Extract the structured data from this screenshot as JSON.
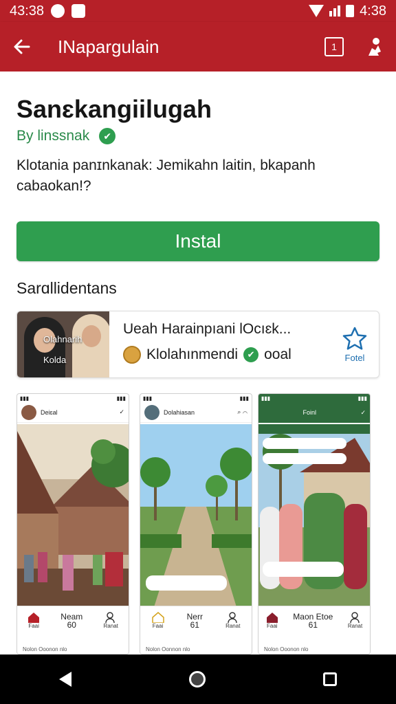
{
  "status_bar": {
    "time_left": "43:38",
    "time_right": "4:38"
  },
  "app_bar": {
    "title": "INapargulain",
    "action_box_label": "1"
  },
  "app": {
    "name": "Sanɛkangiilugah",
    "developer": "By linssnak",
    "description": "Klotania panɪnkanak: Jemikahn laitin, bkapanh cabaokan!?",
    "install_label": "Instal"
  },
  "section": {
    "title": "Sarɑllidentans"
  },
  "feature": {
    "thumb_line1": "Olahnarih",
    "thumb_line2": "Kolda",
    "title": "Ueah Harainpıani lOcıɛk...",
    "sub": "Klolahınmendi",
    "tag": "ooal",
    "star_label": "Fotel"
  },
  "screenshots": [
    {
      "header": "Deiɛal",
      "nav": {
        "home": "Neam",
        "home_sub": "Faai",
        "mid": "60",
        "right": "Ranat",
        "footer": "Nolon Ooonon nlo"
      }
    },
    {
      "header": "Dolahiasan",
      "nav": {
        "home": "Nerr",
        "home_sub": "Faai",
        "mid": "61",
        "right": "Ranat",
        "footer": "Nolon Oonnon nlo"
      }
    },
    {
      "header": "Foinl",
      "nav": {
        "home": "Maon Etoe",
        "home_sub": "Faai",
        "mid": "61",
        "right": "Ranat",
        "footer": "Nolon Ooonon nlo"
      }
    }
  ],
  "colors": {
    "app_bar": "#b62028",
    "install": "#2f9e4f",
    "verify": "#2e9e4f",
    "star": "#1e6fb0"
  }
}
